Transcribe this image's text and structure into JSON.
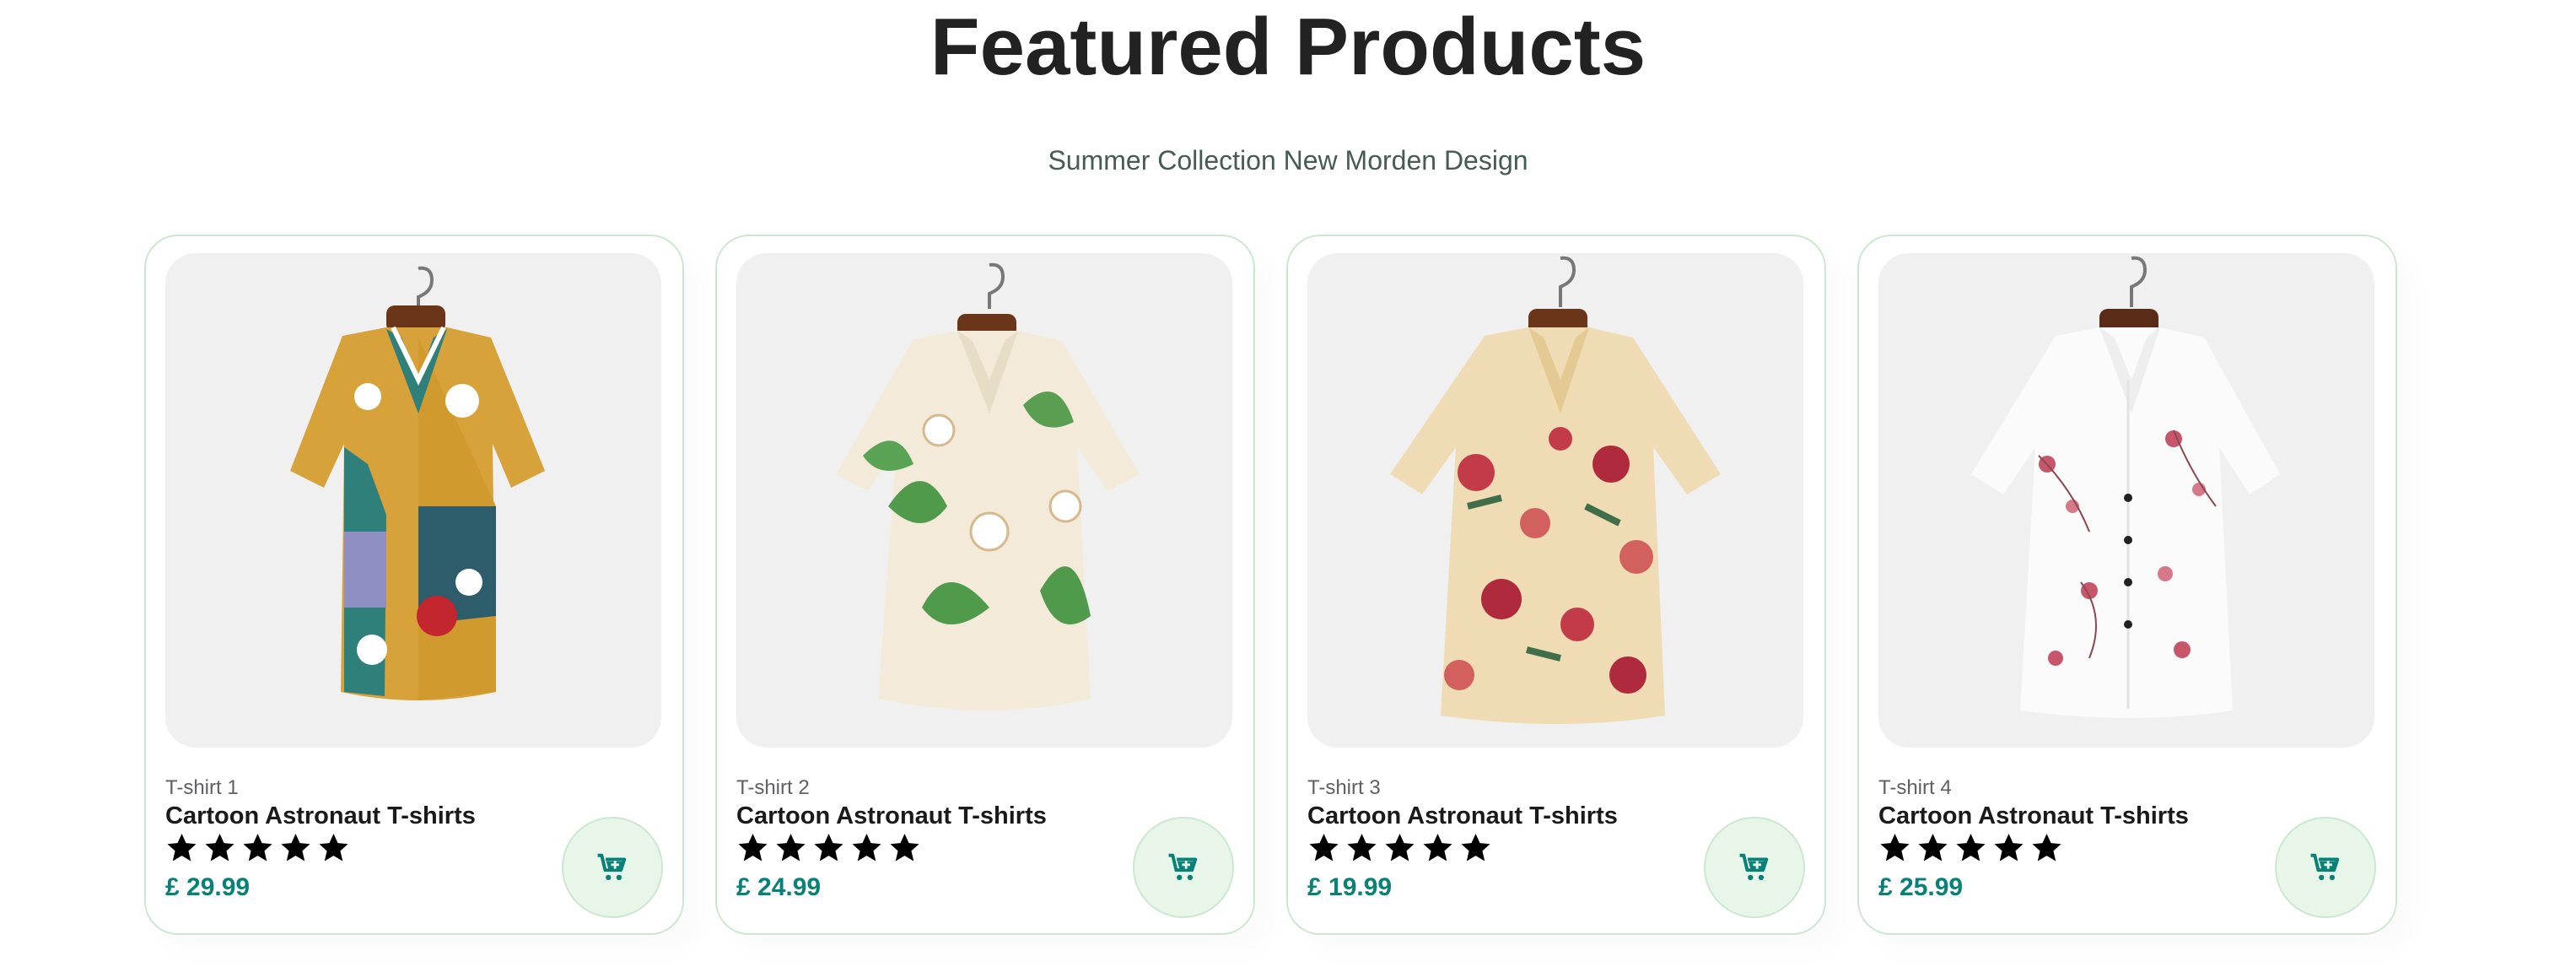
{
  "header": {
    "title": "Featured Products",
    "subtitle": "Summer Collection New Morden Design"
  },
  "products": [
    {
      "brand": "T-shirt 1",
      "name": "Cartoon Astronaut T-shirts",
      "price": "£ 29.99",
      "rating": 5
    },
    {
      "brand": "T-shirt 2",
      "name": "Cartoon Astronaut T-shirts",
      "price": "£ 24.99",
      "rating": 5
    },
    {
      "brand": "T-shirt 3",
      "name": "Cartoon Astronaut T-shirts",
      "price": "£ 19.99",
      "rating": 5
    },
    {
      "brand": "T-shirt 4",
      "name": "Cartoon Astronaut T-shirts",
      "price": "£ 25.99",
      "rating": 5
    }
  ],
  "icons": {
    "star": "star-icon",
    "cart": "add-to-cart-icon"
  },
  "colors": {
    "accent": "#088178",
    "border": "#cce7d0",
    "cart_bg": "#e8f6ea",
    "image_bg": "#f0f0f0"
  }
}
